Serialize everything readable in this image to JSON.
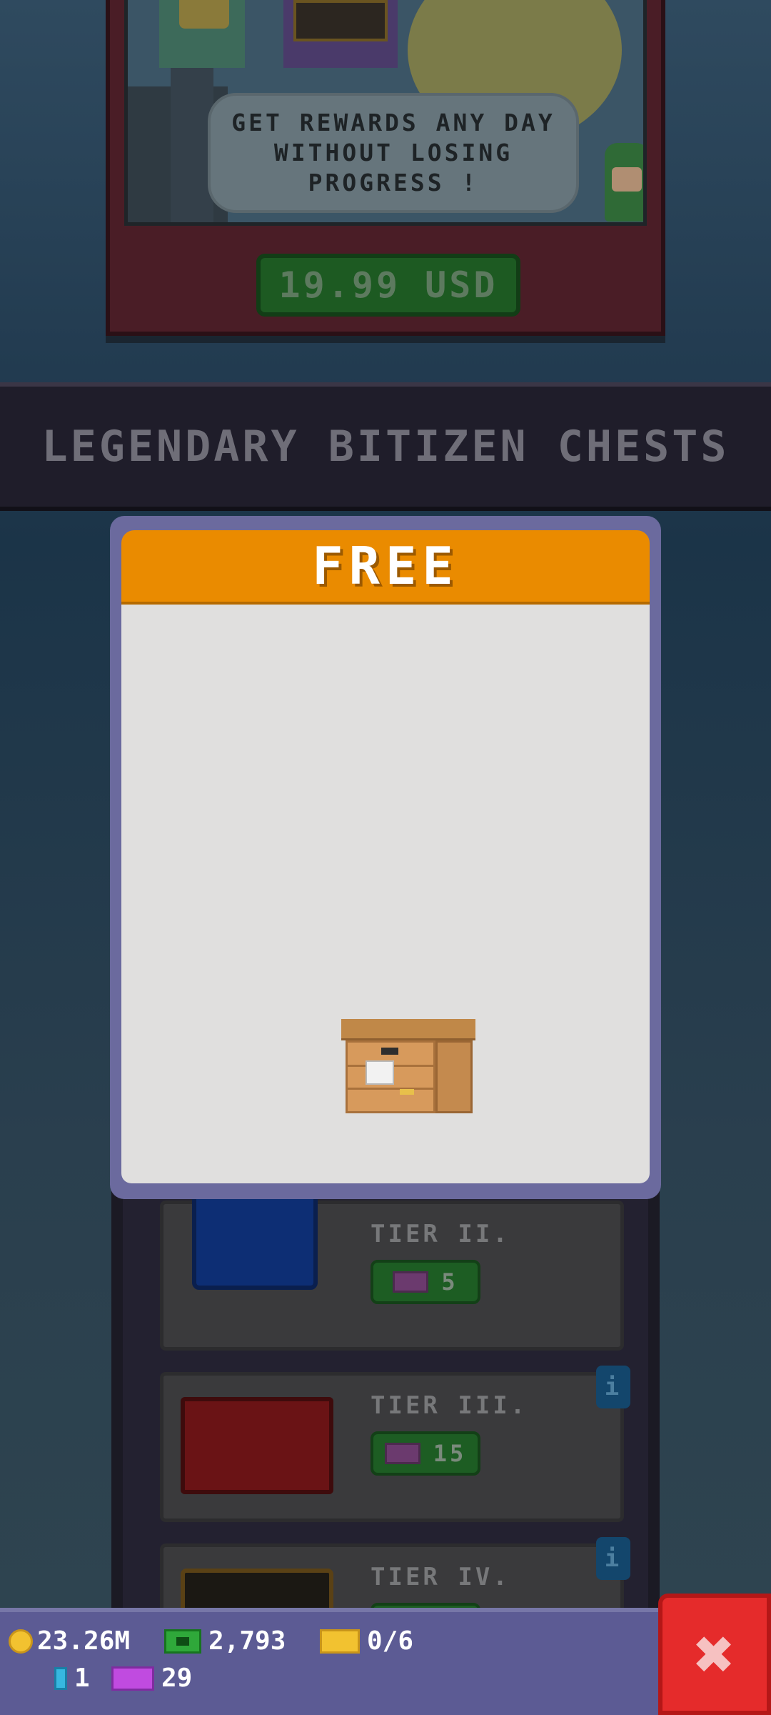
{
  "offer": {
    "speech_text": "GET REWARDS ANY DAY WITHOUT LOSING PROGRESS !",
    "price_label": "19.99 USD"
  },
  "section": {
    "title": "LEGENDARY BITIZEN CHESTS"
  },
  "modal": {
    "title": "FREE",
    "accent_color": "#ea8b00",
    "reward_icon": "wooden-crate-icon"
  },
  "tiers": [
    {
      "label": "TIER II.",
      "cost": "5"
    },
    {
      "label": "TIER III.",
      "cost": "15"
    },
    {
      "label": "TIER IV.",
      "cost": ""
    }
  ],
  "info_label": "i",
  "currency": {
    "coins": "23.26M",
    "bux_cash": "2,793",
    "golden_tickets": "0/6",
    "bitbux": "1",
    "tickets": "29"
  },
  "close_label": "✖",
  "colors": {
    "close_red": "#e52b2b",
    "currency_bar": "#5c5b94",
    "buy_green": "#1d5a22"
  }
}
